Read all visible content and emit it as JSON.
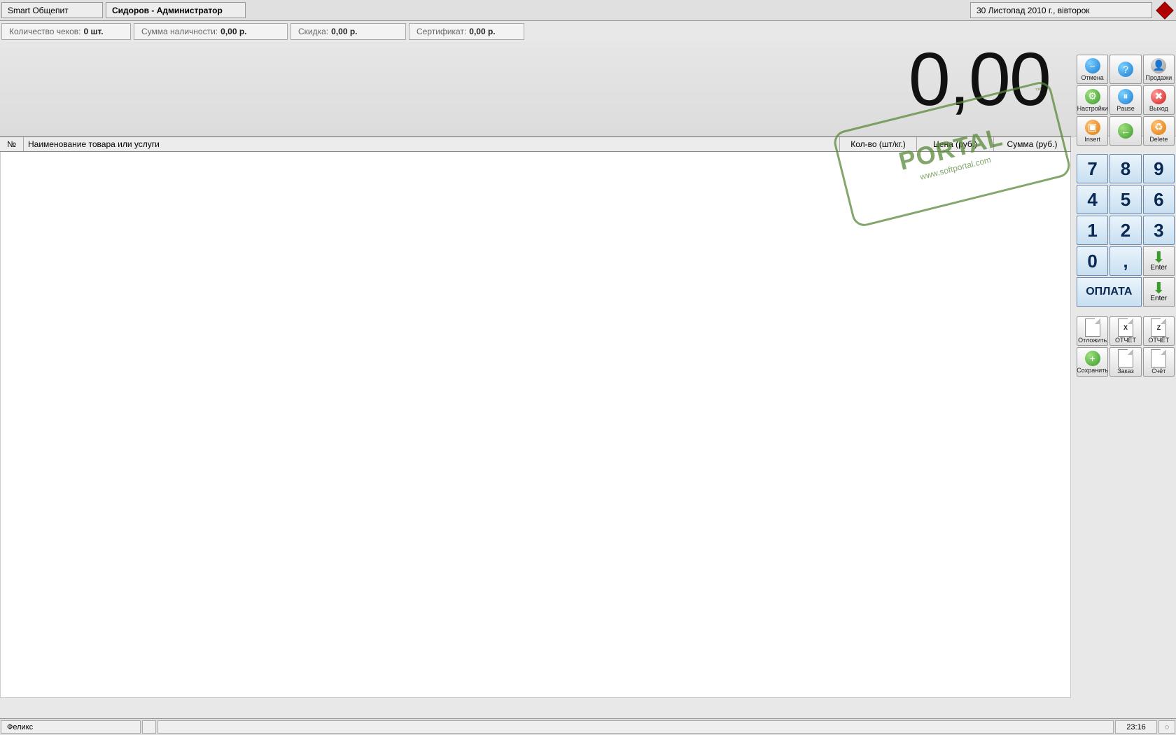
{
  "header": {
    "app_title": "Smart Общепит",
    "user_title": "Сидоров - Администратор",
    "date": "30 Листопад 2010 г., вівторок"
  },
  "stats": {
    "checks_label": "Количество чеков:",
    "checks_value": "0 шт.",
    "cash_label": "Сумма наличности:",
    "cash_value": "0,00 р.",
    "discount_label": "Скидка:",
    "discount_value": "0,00 р.",
    "cert_label": "Сертификат:",
    "cert_value": "0,00 р."
  },
  "total_display": "0,00",
  "grid": {
    "col_num": "№",
    "col_name": "Наименование товара или услуги",
    "col_qty": "Кол-во (шт/кг.)",
    "col_price": "Цена (руб.)",
    "col_sum": "Сумма (руб.)"
  },
  "buttons": {
    "cancel": "Отмена",
    "help": "",
    "sales": "Продажи",
    "settings": "Настройки",
    "pause": "Pause",
    "exit": "Выход",
    "insert": "Insert",
    "back": "",
    "delete": "Delete",
    "pay": "ОПЛАТА",
    "enter": "Enter",
    "defer": "Отложить",
    "xreport": "ОТЧЁТ",
    "zreport": "ОТЧЁТ",
    "save": "Сохранить",
    "order": "Заказ",
    "bill": "Счёт"
  },
  "numpad": [
    "7",
    "8",
    "9",
    "4",
    "5",
    "6",
    "1",
    "2",
    "3",
    "0",
    ","
  ],
  "watermark": {
    "main": "PORTAL",
    "sub": "www.softportal.com",
    "tm": "™"
  },
  "statusbar": {
    "device": "Феликс",
    "time": "23:16"
  }
}
